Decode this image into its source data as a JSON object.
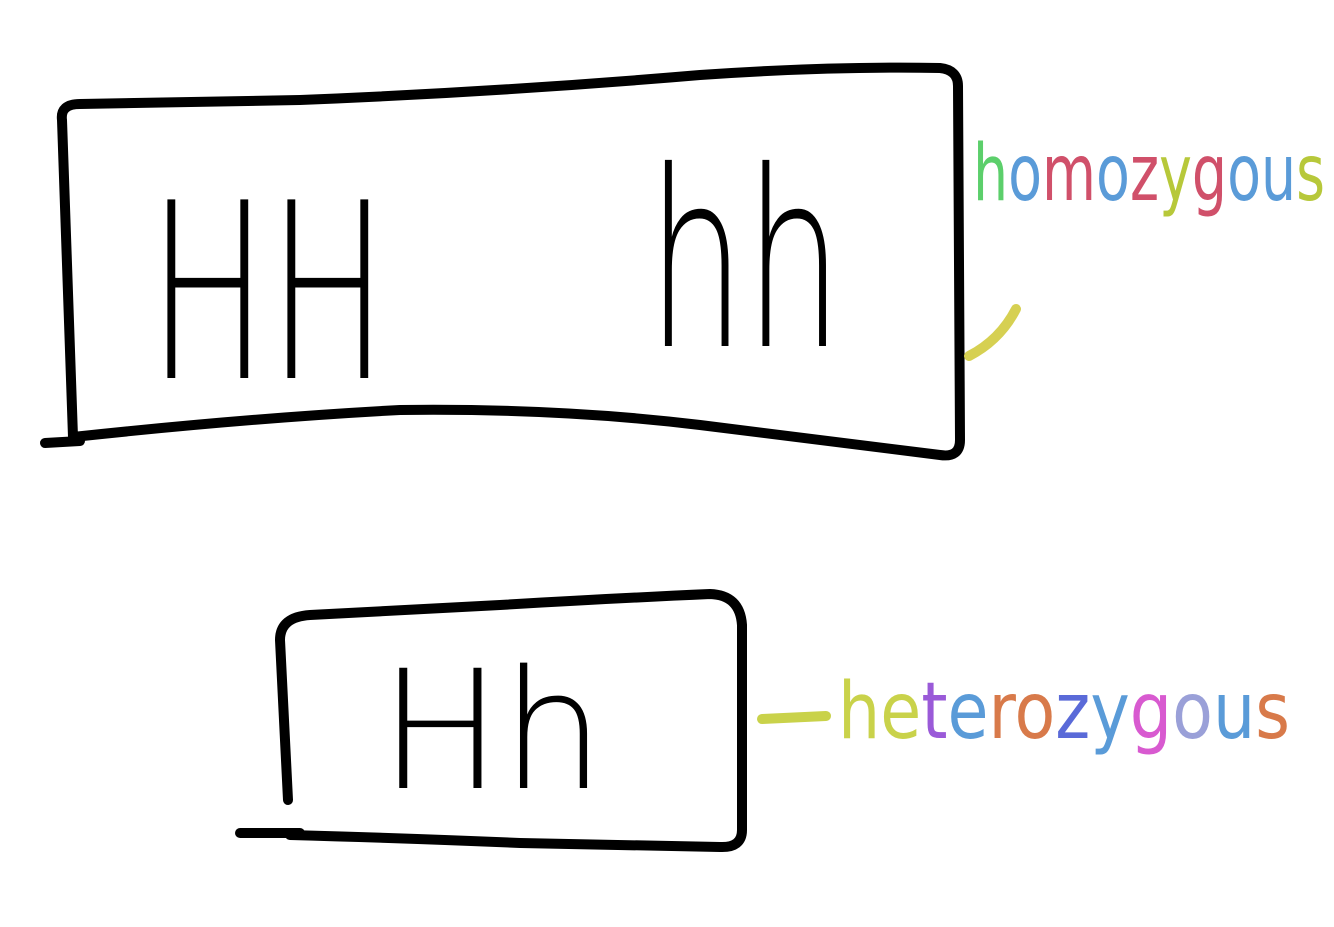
{
  "homozygous_group": {
    "genotypes": [
      "HH",
      "hh"
    ],
    "label": "homozygous",
    "bracket_color": "#d6d052",
    "label_colors": [
      "#5ccf6b",
      "#5a9bd8",
      "#d0506a",
      "#5a9bd8",
      "#d0506a",
      "#b7c83a",
      "#d0506a",
      "#5a9bd8",
      "#5a9bd8",
      "#b7c83a",
      "#6ad8d4"
    ]
  },
  "heterozygous_group": {
    "genotypes": [
      "Hh"
    ],
    "label": "heterozygous",
    "bracket_color": "#c9d24a",
    "label_colors": [
      "#c9d24a",
      "#c9d24a",
      "#9a5ad8",
      "#5a9bd8",
      "#d87a4a",
      "#d87a4a",
      "#5a6ad8",
      "#5a9bd8",
      "#d85ad0",
      "#9aa0d8",
      "#5a9bd8",
      "#d87a4a"
    ]
  }
}
